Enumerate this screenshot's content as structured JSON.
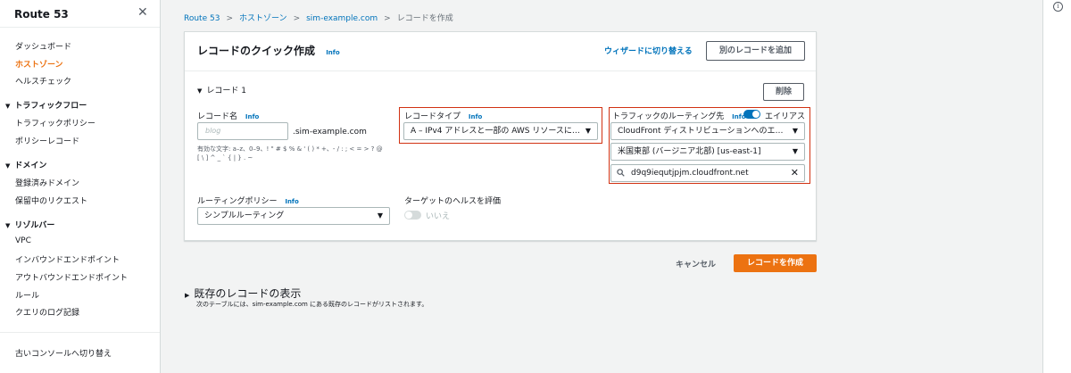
{
  "sidebar": {
    "title": "Route 53",
    "items": {
      "dashboard": "ダッシュボード",
      "hosted_zones": "ホストゾーン",
      "health_checks": "ヘルスチェック",
      "traffic_policies": "トラフィックポリシー",
      "policy_records": "ポリシーレコード",
      "registered_domains": "登録済みドメイン",
      "pending_requests": "保留中のリクエスト",
      "vpc": "VPC",
      "inbound_endpoints": "インバウンドエンドポイント",
      "outbound_endpoints": "アウトバウンドエンドポイント",
      "rules": "ルール",
      "query_logging": "クエリのログ記録",
      "old_console": "古いコンソールへ切り替え"
    },
    "sections": {
      "traffic_flow": "トラフィックフロー",
      "domains": "ドメイン",
      "resolver": "リゾルバー"
    }
  },
  "breadcrumb": {
    "route53": "Route 53",
    "hosted_zones": "ホストゾーン",
    "zone": "sim-example.com",
    "current": "レコードを作成",
    "separator": ">"
  },
  "card": {
    "title": "レコードのクイック作成",
    "info": "Info",
    "wizard_link": "ウィザードに切り替える",
    "add_record_button": "別のレコードを追加"
  },
  "record": {
    "header": "レコード 1",
    "delete_button": "削除",
    "name_label": "レコード名",
    "name_info": "Info",
    "name_placeholder": "blog",
    "name_suffix": ".sim-example.com",
    "name_hint_line1": "有効な文字: a–z、0–9、! \" # $ % & ' ( ) * +、- / : ; < = > ? @",
    "name_hint_line2": "[ \\ ] ^ _ ` { | } . ~",
    "type_label": "レコードタイプ",
    "type_info": "Info",
    "type_value": "A – IPv4 アドレスと一部の AWS リソースに…",
    "routing_target_label": "トラフィックのルーティング先",
    "routing_target_info": "Info",
    "alias_label": "エイリアス",
    "endpoint_value": "CloudFront ディストリビューションへのエ…",
    "region_value": "米国東部 (バージニア北部) [us-east-1]",
    "distribution_value": "d9q9iequtjpjm.cloudfront.net",
    "routing_policy_label": "ルーティングポリシー",
    "routing_policy_info": "Info",
    "routing_policy_value": "シンプルルーティング",
    "health_label": "ターゲットのヘルスを評価",
    "health_value": "いいえ"
  },
  "actions": {
    "cancel": "キャンセル",
    "create": "レコードを作成"
  },
  "existing": {
    "header": "既存のレコードの表示",
    "description": "次のテーブルには、sim-example.com にある既存のレコードがリストされます。"
  },
  "colors": {
    "accent": "#ec7211",
    "link": "#0073bb",
    "highlight_box": "#d13212"
  }
}
